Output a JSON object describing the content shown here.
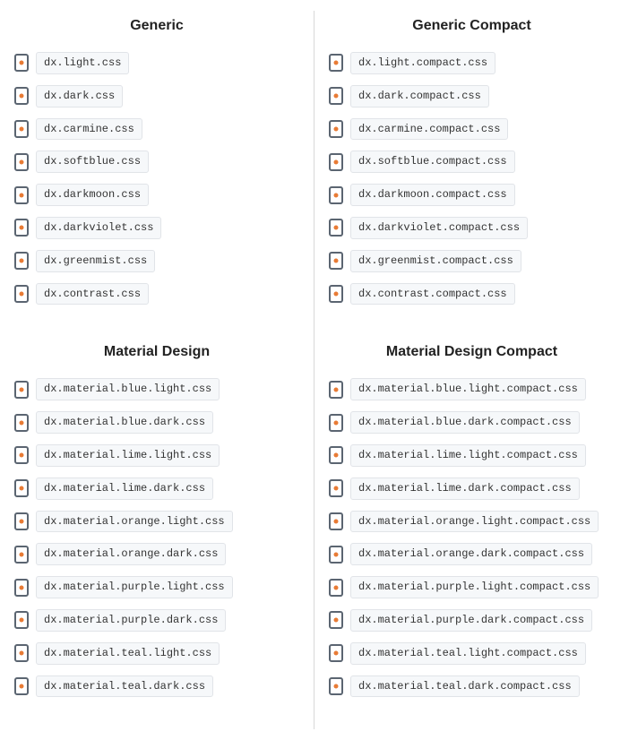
{
  "sections": [
    {
      "title": "Generic",
      "files": [
        "dx.light.css",
        "dx.dark.css",
        "dx.carmine.css",
        "dx.softblue.css",
        "dx.darkmoon.css",
        "dx.darkviolet.css",
        "dx.greenmist.css",
        "dx.contrast.css"
      ]
    },
    {
      "title": "Generic Compact",
      "files": [
        "dx.light.compact.css",
        "dx.dark.compact.css",
        "dx.carmine.compact.css",
        "dx.softblue.compact.css",
        "dx.darkmoon.compact.css",
        "dx.darkviolet.compact.css",
        "dx.greenmist.compact.css",
        "dx.contrast.compact.css"
      ]
    },
    {
      "title": "Material Design",
      "files": [
        "dx.material.blue.light.css",
        "dx.material.blue.dark.css",
        "dx.material.lime.light.css",
        "dx.material.lime.dark.css",
        "dx.material.orange.light.css",
        "dx.material.orange.dark.css",
        "dx.material.purple.light.css",
        "dx.material.purple.dark.css",
        "dx.material.teal.light.css",
        "dx.material.teal.dark.css"
      ]
    },
    {
      "title": "Material Design Compact",
      "files": [
        "dx.material.blue.light.compact.css",
        "dx.material.blue.dark.compact.css",
        "dx.material.lime.light.compact.css",
        "dx.material.lime.dark.compact.css",
        "dx.material.orange.light.compact.css",
        "dx.material.orange.dark.compact.css",
        "dx.material.purple.light.compact.css",
        "dx.material.purple.dark.compact.css",
        "dx.material.teal.light.compact.css",
        "dx.material.teal.dark.compact.css"
      ]
    }
  ]
}
